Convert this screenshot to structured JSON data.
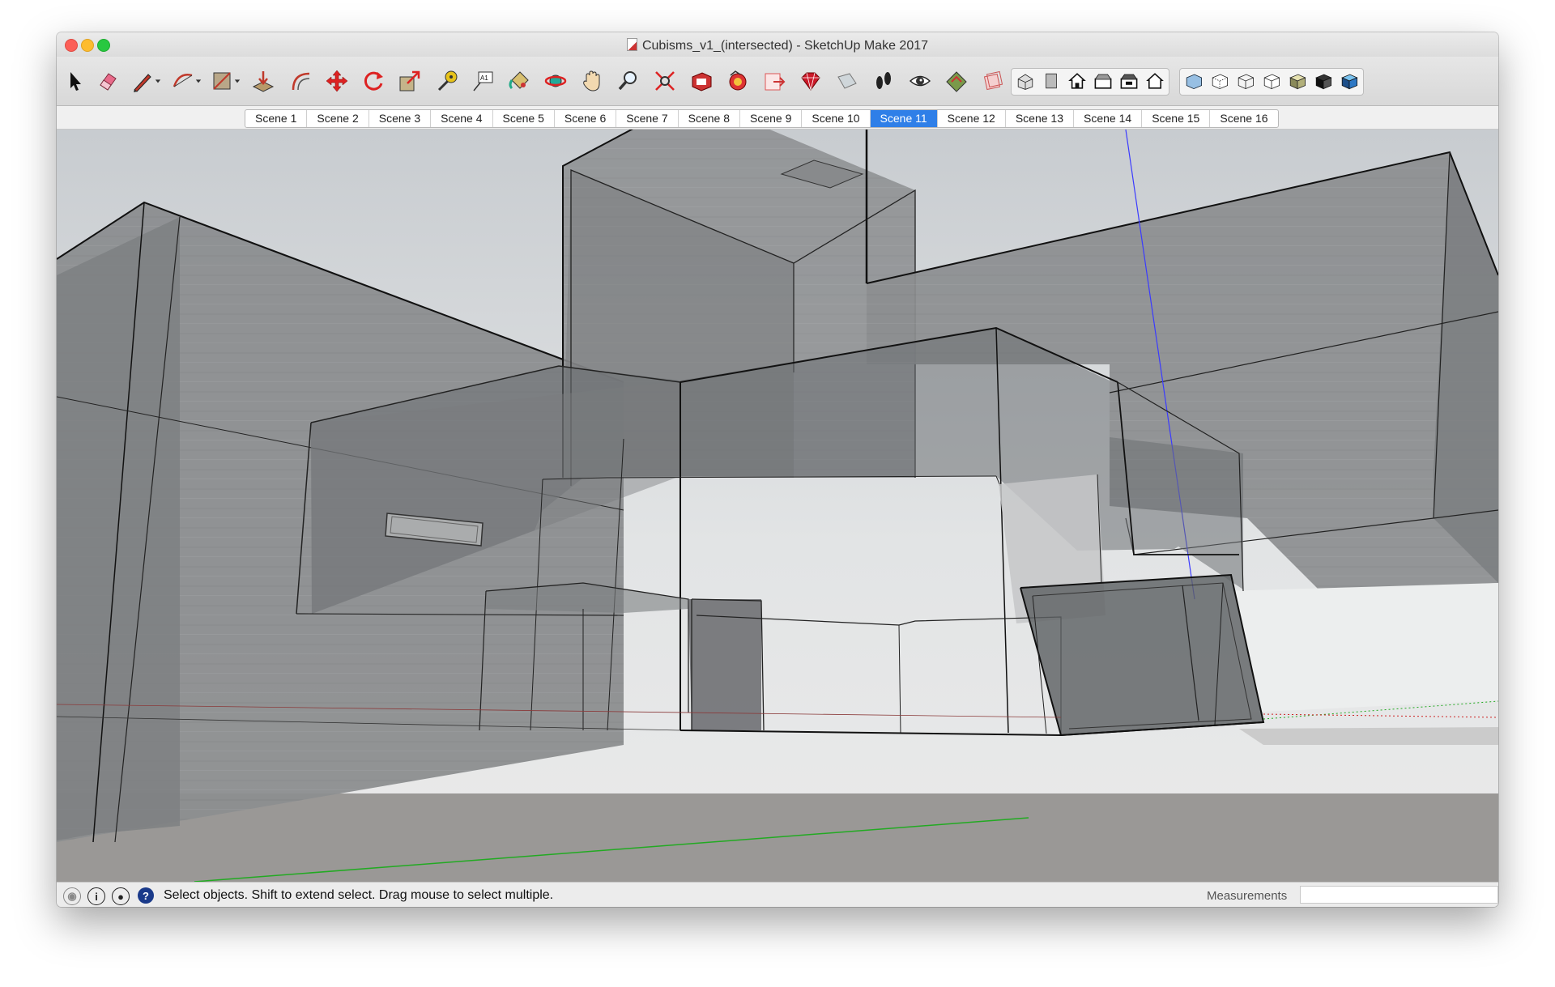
{
  "window": {
    "title": "Cubisms_v1_(intersected) - SketchUp Make 2017"
  },
  "toolbar": {
    "tools": [
      "select-tool",
      "eraser-tool",
      "line-tool",
      "arc-tool",
      "rectangle-tool",
      "push-pull-tool",
      "offset-tool",
      "move-tool",
      "rotate-tool",
      "scale-tool",
      "tape-measure-tool",
      "text-tool",
      "paint-bucket-tool",
      "orbit-tool",
      "pan-tool",
      "zoom-tool",
      "zoom-extents-tool",
      "3d-warehouse-tool",
      "extension-warehouse-tool",
      "layout-tool",
      "ruby-console-tool",
      "section-plane-tool",
      "walk-tool",
      "look-around-tool",
      "sandbox-tool",
      "styles-tool"
    ],
    "views": [
      "iso-view",
      "top-view",
      "front-view",
      "right-view",
      "back-view",
      "left-view"
    ],
    "styles": [
      "xray-style",
      "back-edges-style",
      "wireframe-style",
      "hidden-line-style",
      "shaded-style",
      "shaded-textures-style",
      "monochrome-style"
    ]
  },
  "scenes": {
    "tabs": [
      "Scene 1",
      "Scene 2",
      "Scene 3",
      "Scene 4",
      "Scene 5",
      "Scene 6",
      "Scene 7",
      "Scene 8",
      "Scene 9",
      "Scene 10",
      "Scene 11",
      "Scene 12",
      "Scene 13",
      "Scene 14",
      "Scene 15",
      "Scene 16"
    ],
    "active": "Scene 11"
  },
  "status": {
    "message": "Select objects. Shift to extend select. Drag mouse to select multiple.",
    "measurements_label": "Measurements",
    "measurements_value": ""
  },
  "colors": {
    "active_tab": "#2f7fe8",
    "concrete": "#8a8c8e",
    "edge": "#1a1a1a",
    "axis_blue": "#3a3aff",
    "axis_red": "#cc2222",
    "axis_green": "#22aa22"
  }
}
